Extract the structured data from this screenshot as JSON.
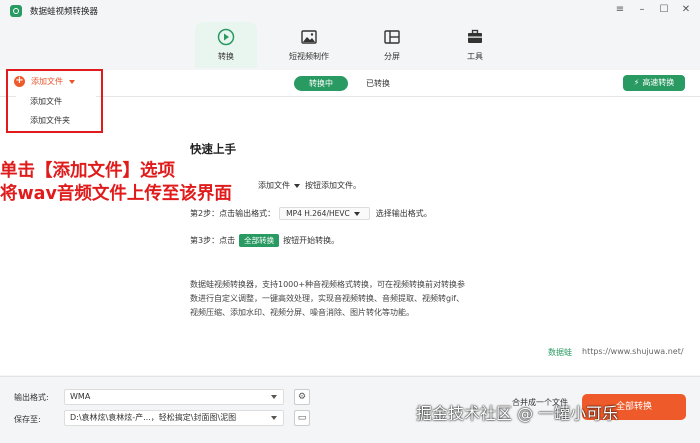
{
  "titlebar": {
    "title": "数据蛙视频转换器",
    "controls": [
      "≡",
      "–",
      "☐",
      "✕"
    ]
  },
  "tabs": [
    {
      "label": "转换",
      "icon": "convert-icon",
      "active": true
    },
    {
      "label": "短视频制作",
      "icon": "image-icon",
      "active": false
    },
    {
      "label": "分屏",
      "icon": "split-screen-icon",
      "active": false
    },
    {
      "label": "工具",
      "icon": "toolbox-icon",
      "active": false
    }
  ],
  "subbar": {
    "add_file_label": "添加文件",
    "converting_label": "转换中",
    "converted_label": "已转换",
    "fast_convert_label": "高速转换"
  },
  "dropdown": {
    "items": [
      "添加文件",
      "添加文件夹"
    ]
  },
  "guide": {
    "title": "快速上手",
    "step1_btn": "添加文件",
    "step1_tail": "按钮添加文件。",
    "step2_head": "第2步：点击输出格式：",
    "step2_format": "MP4 H.264/HEVC",
    "step2_tail": "选择输出格式。",
    "step3_head": "第3步：点击",
    "step3_btn": "全部转换",
    "step3_tail": "按钮开始转换。",
    "desc_lines": [
      "数据蛙视频转换器，支持1000+种音视频格式转换，可在视频转换前对转换参",
      "数进行自定义调整，一键高效处理，实现音视频转换、音频提取、视频转gif、",
      "视频压缩、添加水印、视频分屏、噪音消除、图片转化等功能。"
    ]
  },
  "brand": {
    "name": "数据蛙",
    "url": "https://www.shujuwa.net/"
  },
  "annotation": {
    "line1": "单击【添加文件】选项",
    "line2": "将wav音频文件上传至该界面"
  },
  "bottom": {
    "output_format_label": "输出格式:",
    "output_format_value": "WMA",
    "save_to_label": "保存至:",
    "save_to_value": "D:\\袁林炫\\袁林炫-产...，轻松搞定\\封面图\\泥图",
    "merge_label": "合并成一个文件",
    "convert_all_label": "全部转换"
  },
  "watermark": "掘金技术社区 @ 一罐小可乐",
  "colors": {
    "accent_green": "#2a9a63",
    "accent_orange": "#ef5a2a",
    "annotation_red": "#e01b1b"
  }
}
